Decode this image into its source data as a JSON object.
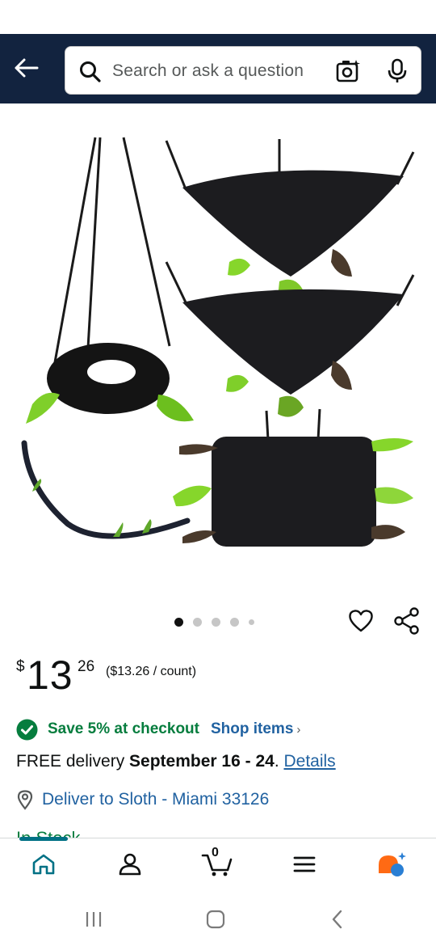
{
  "header": {
    "search_placeholder": "Search or ask a question"
  },
  "product": {
    "image_alt": "Sugar glider hammock and toy set",
    "carousel": {
      "total": 5,
      "active": 1
    },
    "price": {
      "currency": "$",
      "whole": "13",
      "fraction": "26",
      "unit": "($13.26 / count)"
    },
    "promo": {
      "text": "Save 5% at checkout",
      "link": "Shop items",
      "chevron": "›"
    },
    "delivery": {
      "prefix": "FREE delivery ",
      "dates": "September 16 - 24",
      "suffix": ". ",
      "link": "Details"
    },
    "location": "Deliver to Sloth - Miami 33126",
    "stock": "In Stock"
  },
  "bottom_nav": {
    "cart_count": "0"
  },
  "colors": {
    "header_bg": "#12233f",
    "link": "#2162a1",
    "success": "#067d3e",
    "accent_teal": "#007185"
  }
}
